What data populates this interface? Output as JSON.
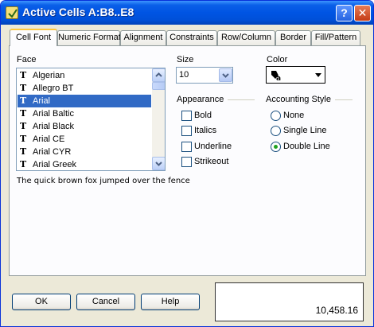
{
  "window": {
    "title": "Active Cells  A:B8..E8",
    "help_glyph": "?",
    "close_glyph": "✕"
  },
  "tabs": [
    {
      "label": "Cell Font",
      "active": true
    },
    {
      "label": "Numeric Format"
    },
    {
      "label": "Alignment"
    },
    {
      "label": "Constraints"
    },
    {
      "label": "Row/Column"
    },
    {
      "label": "Border"
    },
    {
      "label": "Fill/Pattern"
    }
  ],
  "face": {
    "label": "Face",
    "items": [
      "Algerian",
      "Allegro BT",
      "Arial",
      "Arial Baltic",
      "Arial Black",
      "Arial CE",
      "Arial CYR",
      "Arial Greek"
    ],
    "selected": "Arial",
    "glyph": "T"
  },
  "sample_text": "The quick brown fox jumped over the fence",
  "size": {
    "label": "Size",
    "value": "10"
  },
  "color": {
    "label": "Color"
  },
  "appearance": {
    "label": "Appearance",
    "options": [
      "Bold",
      "Italics",
      "Underline",
      "Strikeout"
    ]
  },
  "accounting": {
    "label": "Accounting Style",
    "options": [
      "None",
      "Single Line",
      "Double Line"
    ],
    "selected": "Double Line"
  },
  "buttons": {
    "ok": "OK",
    "cancel": "Cancel",
    "help": "Help"
  },
  "preview_value": "10,458.16",
  "colors": {
    "selection": "#316ac5",
    "radio_dot": "#21a121",
    "title_bar": "#0054e3"
  }
}
